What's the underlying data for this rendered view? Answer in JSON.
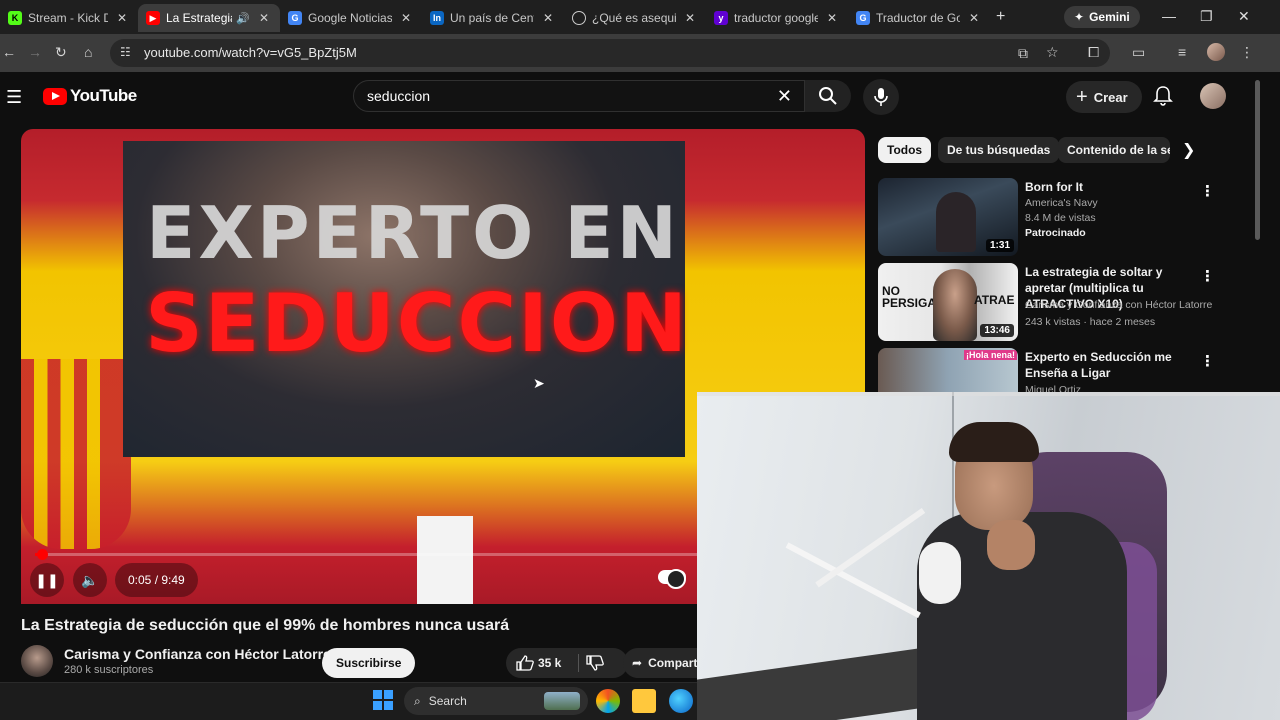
{
  "browser": {
    "tabs": [
      {
        "title": "Stream - Kick Dash",
        "favicon": "K",
        "color": "#53fc18"
      },
      {
        "title": "La Estrategia d",
        "favicon": "",
        "color": "#ff0000",
        "active": true,
        "audio": true
      },
      {
        "title": "Google Noticias - I",
        "favicon": "G",
        "color": "#4285f4"
      },
      {
        "title": "Un país de Centro",
        "favicon": "In",
        "color": "#0a66c2"
      },
      {
        "title": "¿Qué es asequibilid",
        "favicon": "",
        "color": "#aaaaaa"
      },
      {
        "title": "traductor google -",
        "favicon": "y",
        "color": "#6001d2"
      },
      {
        "title": "Traductor de Goog",
        "favicon": "G",
        "color": "#4285f4"
      }
    ],
    "gemini_label": "Gemini",
    "url": "youtube.com/watch?v=vG5_BpZtj5M"
  },
  "youtube": {
    "logo_text": "YouTube",
    "search_value": "seduccion",
    "create_label": "Crear",
    "video": {
      "overlay_line1": "EXPERTO EN",
      "overlay_line2": "SEDUCCION",
      "time": "0:05 / 9:49",
      "progress": 0.009,
      "title": "La Estrategia de seducción que el 99% de hombres nunca usará",
      "channel": "Carisma y Confianza con Héctor Latorre",
      "subscribers": "280 k suscriptores",
      "subscribe_label": "Suscribirse",
      "likes": "35 k",
      "share_label": "Compartir"
    },
    "chips": [
      "Todos",
      "De tus búsquedas",
      "Contenido de la ser"
    ],
    "recommendations": [
      {
        "title": "Born for It",
        "channel": "America's Navy",
        "stats": "8.4 M de vistas",
        "badge": "Patrocinado",
        "duration": "1:31"
      },
      {
        "title": "La estrategia de soltar y apretar (multiplica tu ATRACTIVO X10)",
        "channel": "Carisma y Confianza con Héctor Latorre",
        "stats": "243 k vistas · hace 2 meses",
        "duration": "13:46",
        "thumb_text1": "NO PERSIGAS",
        "thumb_text2": "ATRAE"
      },
      {
        "title": "Experto en Seducción me Enseña a Ligar",
        "channel": "Miguel Ortiz",
        "thumb_text1": "¡Hola nena!"
      }
    ]
  },
  "taskbar": {
    "search_label": "Search"
  }
}
